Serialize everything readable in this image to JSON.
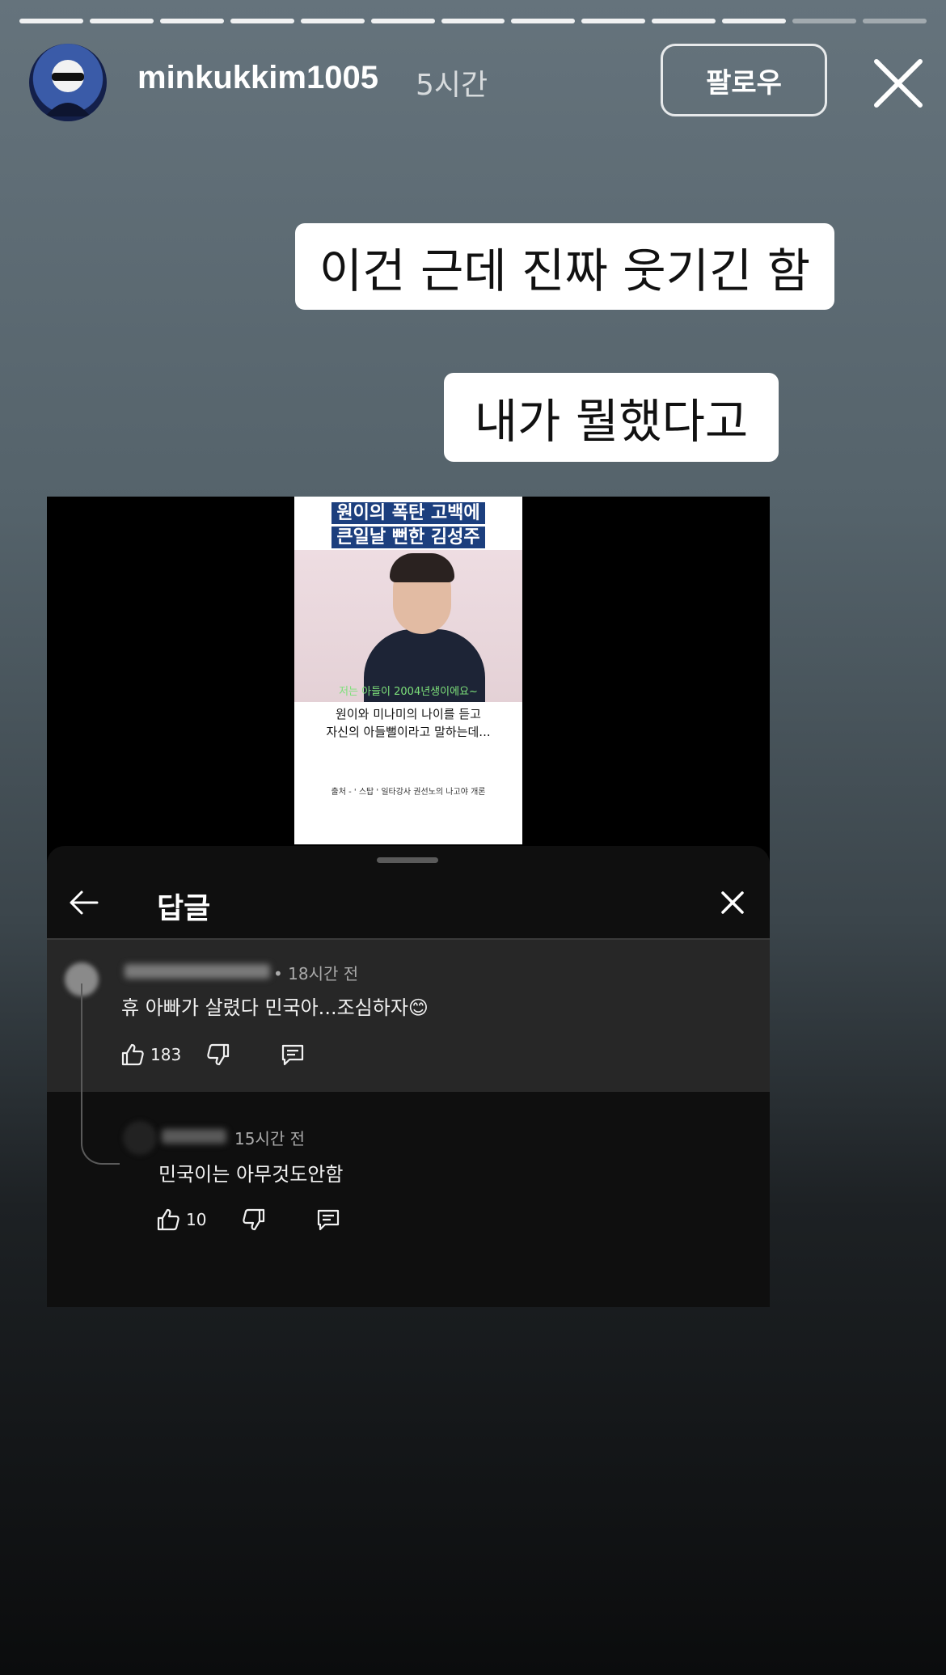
{
  "story": {
    "progress_total": 13,
    "progress_viewed": 11,
    "username": "minkukkim1005",
    "time": "5시간",
    "follow_label": "팔로우",
    "captions": [
      "이건 근데 진짜 웃기긴 함",
      "내가 뭘했다고"
    ]
  },
  "video": {
    "title_line1": "원이의 폭탄 고백에",
    "title_line2": "큰일날 뻔한 김성주",
    "subtitle": "저는 아들이 2004년생이에요~",
    "text_line1": "원이와 미나미의 나이를 듣고",
    "text_line2": "자신의 아들뻘이라고 말하는데...",
    "source": "출처 - ' 스탑 ' 일타강사 권선노의 나고야 개론"
  },
  "sheet": {
    "title": "답글",
    "comment": {
      "time": "• 18시간 전",
      "text": "휴 아빠가 살렸다 민국아...조심하자😊",
      "likes": "183"
    },
    "reply": {
      "time": "15시간 전",
      "text": "민국이는 아무것도안함",
      "likes": "10"
    }
  },
  "colors": {
    "accent_bg": "#65737c",
    "sheet_bg": "#0f0f0f",
    "comment_bg": "#272727",
    "video_title_bg": "#1c3f7e"
  },
  "icons": [
    "close-icon",
    "back-arrow-icon",
    "like-icon",
    "dislike-icon",
    "reply-icon"
  ]
}
